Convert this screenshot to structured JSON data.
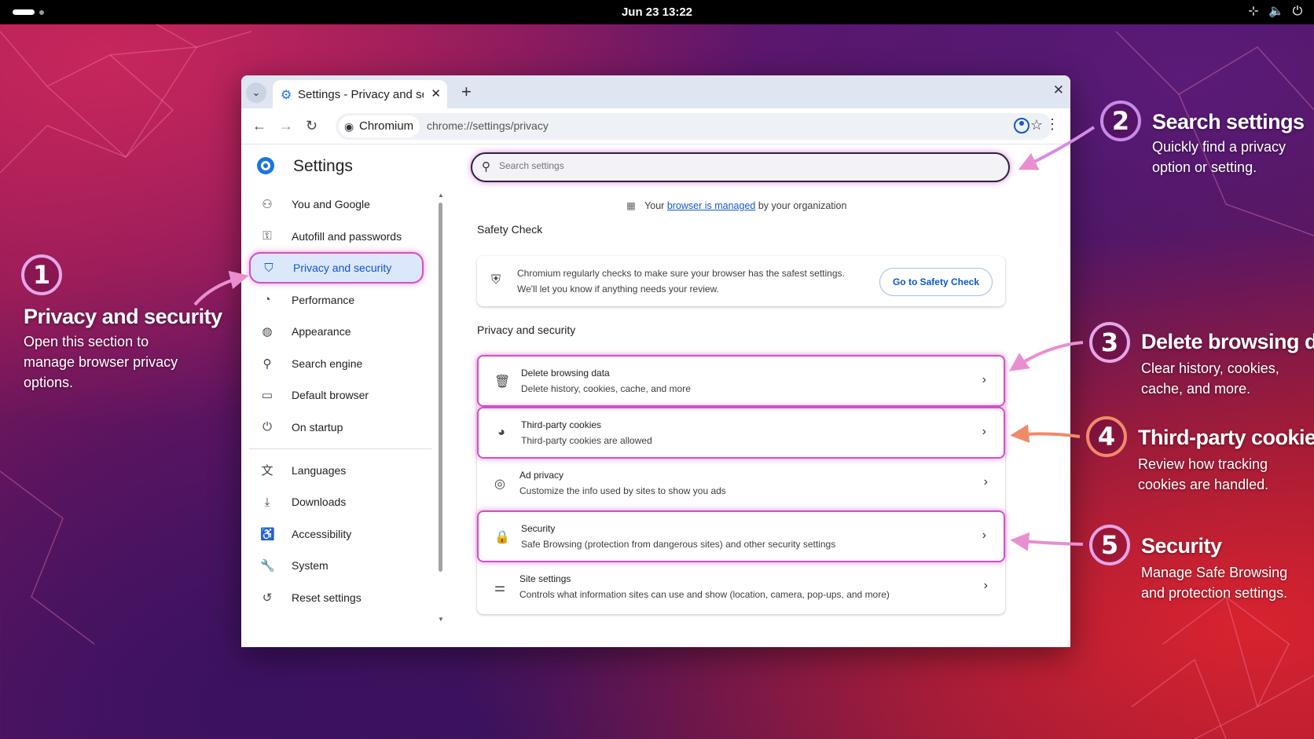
{
  "topbar": {
    "clock": "Jun 23  13:22"
  },
  "browser": {
    "tab_title": "Settings - Privacy and se",
    "new_tab": "+",
    "close_window": "✕",
    "chip_label": "Chromium",
    "url": "chrome://settings/privacy"
  },
  "settings": {
    "title": "Settings",
    "nav": [
      {
        "label": "You and Google",
        "icon": "person-icon"
      },
      {
        "label": "Autofill and passwords",
        "icon": "key-icon"
      },
      {
        "label": "Privacy and security",
        "icon": "shield-icon",
        "active": true
      },
      {
        "label": "Performance",
        "icon": "gauge-icon"
      },
      {
        "label": "Appearance",
        "icon": "palette-icon"
      },
      {
        "label": "Search engine",
        "icon": "search-icon"
      },
      {
        "label": "Default browser",
        "icon": "browser-window-icon"
      },
      {
        "label": "On startup",
        "icon": "power-icon"
      },
      {
        "label": "Languages",
        "icon": "translate-icon"
      },
      {
        "label": "Downloads",
        "icon": "download-icon"
      },
      {
        "label": "Accessibility",
        "icon": "accessibility-icon"
      },
      {
        "label": "System",
        "icon": "wrench-icon"
      },
      {
        "label": "Reset settings",
        "icon": "reset-icon"
      }
    ],
    "search_placeholder": "Search settings",
    "managed": {
      "prefix": "Your",
      "link": "browser is managed",
      "suffix": "by your organization"
    },
    "safety_check": {
      "heading": "Safety Check",
      "text": "Chromium regularly checks to make sure your browser has the safest settings. We'll let you know if anything needs your review.",
      "button": "Go to Safety Check"
    },
    "privacy": {
      "heading": "Privacy and security",
      "rows": [
        {
          "title": "Delete browsing data",
          "desc": "Delete history, cookies, cache, and more",
          "icon": "trash-icon",
          "highlighted": true
        },
        {
          "title": "Third-party cookies",
          "desc": "Third-party cookies are allowed",
          "icon": "cookie-icon",
          "highlighted": true
        },
        {
          "title": "Ad privacy",
          "desc": "Customize the info used by sites to show you ads",
          "icon": "ad-privacy-icon",
          "highlighted": false
        },
        {
          "title": "Security",
          "desc": "Safe Browsing (protection from dangerous sites) and other security settings",
          "icon": "lock-icon",
          "highlighted": true
        },
        {
          "title": "Site settings",
          "desc": "Controls what information sites can use and show (location, camera, pop-ups, and more)",
          "icon": "sliders-icon",
          "highlighted": false
        }
      ]
    }
  },
  "callouts": [
    {
      "num": "1",
      "title": "Privacy and security",
      "desc": [
        "Open this section to",
        "manage browser privacy",
        "options."
      ]
    },
    {
      "num": "2",
      "title": "Search settings",
      "desc": [
        "Quickly find a privacy",
        "option or setting."
      ]
    },
    {
      "num": "3",
      "title": "Delete browsing data",
      "desc": [
        "Clear history, cookies,",
        "cache, and more."
      ]
    },
    {
      "num": "4",
      "title": "Third-party cookies",
      "desc": [
        "Review how tracking",
        "cookies are handled."
      ]
    },
    {
      "num": "5",
      "title": "Security",
      "desc": [
        "Manage Safe Browsing",
        "and protection settings."
      ]
    }
  ],
  "colors": {
    "highlight": "#d54fc6",
    "accent": "#0b57d0"
  }
}
